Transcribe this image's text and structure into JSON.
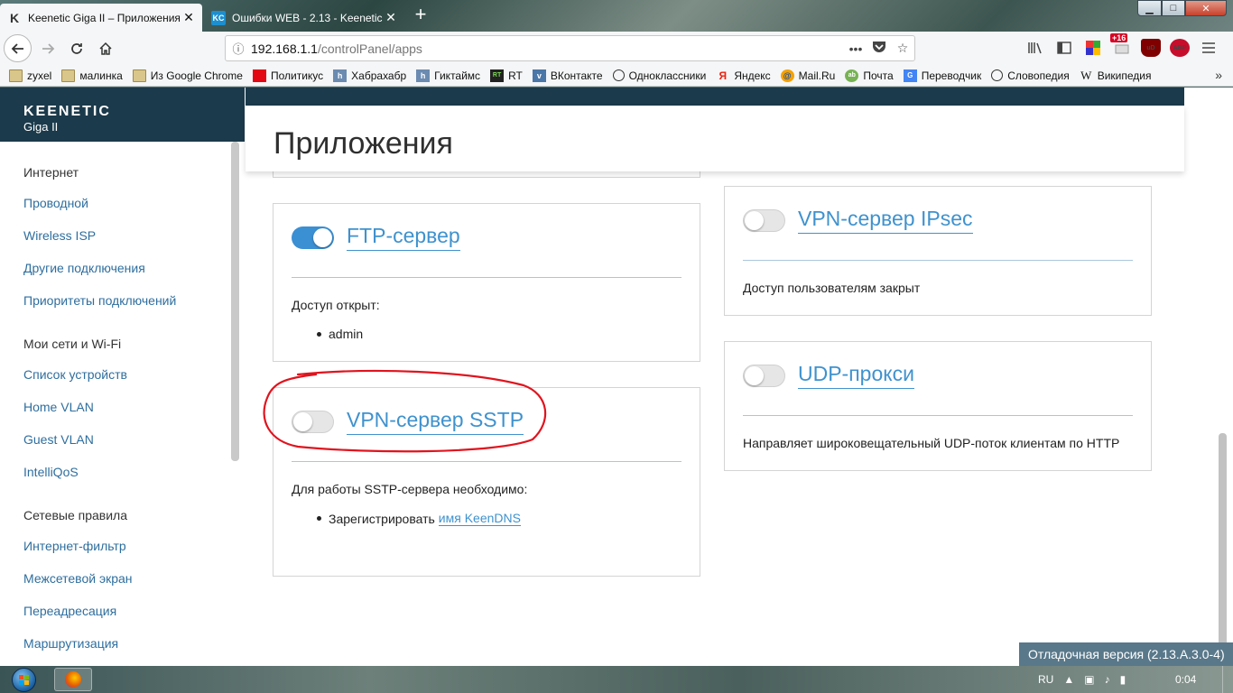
{
  "browser": {
    "tabs": [
      {
        "title": "Keenetic Giga II – Приложения",
        "favicon": "K",
        "active": true
      },
      {
        "title": "Ошибки WEB - 2.13 - Keenetic",
        "favicon": "KC",
        "active": false
      }
    ],
    "new_tab": "+",
    "window_controls": {
      "minimize": "▁",
      "maximize": "□",
      "close": "✕"
    },
    "url": {
      "host": "192.168.1.1",
      "path": "/controlPanel/apps"
    },
    "toolbar_badge": "+16",
    "abp_label": "ABP",
    "ud_label": "uD",
    "bookmarks": [
      {
        "label": "zyxel",
        "icon": "folder"
      },
      {
        "label": "малинка",
        "icon": "folder"
      },
      {
        "label": "Из Google Chrome",
        "icon": "folder"
      },
      {
        "label": "Политикус",
        "icon": "red"
      },
      {
        "label": "Хабрахабр",
        "icon": "h"
      },
      {
        "label": "Гиктаймс",
        "icon": "h"
      },
      {
        "label": "RT",
        "icon": "RT"
      },
      {
        "label": "ВКонтакте",
        "icon": "vk"
      },
      {
        "label": "Одноклассники",
        "icon": "globe"
      },
      {
        "label": "Яндекс",
        "icon": "Я"
      },
      {
        "label": "Mail.Ru",
        "icon": "@"
      },
      {
        "label": "Почта",
        "icon": "pochta"
      },
      {
        "label": "Переводчик",
        "icon": "G"
      },
      {
        "label": "Словопедия",
        "icon": "globe"
      },
      {
        "label": "Википедия",
        "icon": "W"
      }
    ]
  },
  "app": {
    "logo": "KEENETIC",
    "model": "Giga II",
    "page_title": "Приложения",
    "debug_version": "Отладочная версия (2.13.A.3.0-4)"
  },
  "sidebar": {
    "items": [
      {
        "label": "Интернет",
        "group": true
      },
      {
        "label": "Проводной",
        "group": false
      },
      {
        "label": "Wireless ISP",
        "group": false
      },
      {
        "label": "Другие подключения",
        "group": false
      },
      {
        "label": "Приоритеты подключений",
        "group": false
      },
      {
        "label": "Мои сети и Wi-Fi",
        "group": true
      },
      {
        "label": "Список устройств",
        "group": false
      },
      {
        "label": "Home VLAN",
        "group": false
      },
      {
        "label": "Guest VLAN",
        "group": false
      },
      {
        "label": "IntelliQoS",
        "group": false
      },
      {
        "label": "Сетевые правила",
        "group": true
      },
      {
        "label": "Интернет-фильтр",
        "group": false
      },
      {
        "label": "Межсетевой экран",
        "group": false
      },
      {
        "label": "Переадресация",
        "group": false
      },
      {
        "label": "Маршрутизация",
        "group": false
      }
    ]
  },
  "cards": {
    "ftp": {
      "title": "FTP-сервер",
      "enabled": true,
      "text": "Доступ открыт:",
      "list_item": "admin"
    },
    "sstp": {
      "title": "VPN-сервер SSTP",
      "enabled": false,
      "text": "Для работы SSTP-сервера необходимо:",
      "list_item": "Зарегистрировать",
      "link": "имя KeenDNS"
    },
    "ipsec": {
      "title": "VPN-сервер IPsec",
      "enabled": false,
      "text": "Доступ пользователям закрыт"
    },
    "udp": {
      "title": "UDP-прокси",
      "enabled": false,
      "text": "Направляет широковещательный UDP-поток клиентам по HTTP"
    }
  },
  "annotation": {
    "color": "#e0141e"
  },
  "taskbar": {
    "lang": "RU",
    "time": "0:04"
  },
  "colors": {
    "accent": "#3f92ce",
    "header": "#1b3a4b",
    "toggle_on": "#3b8fd3"
  }
}
